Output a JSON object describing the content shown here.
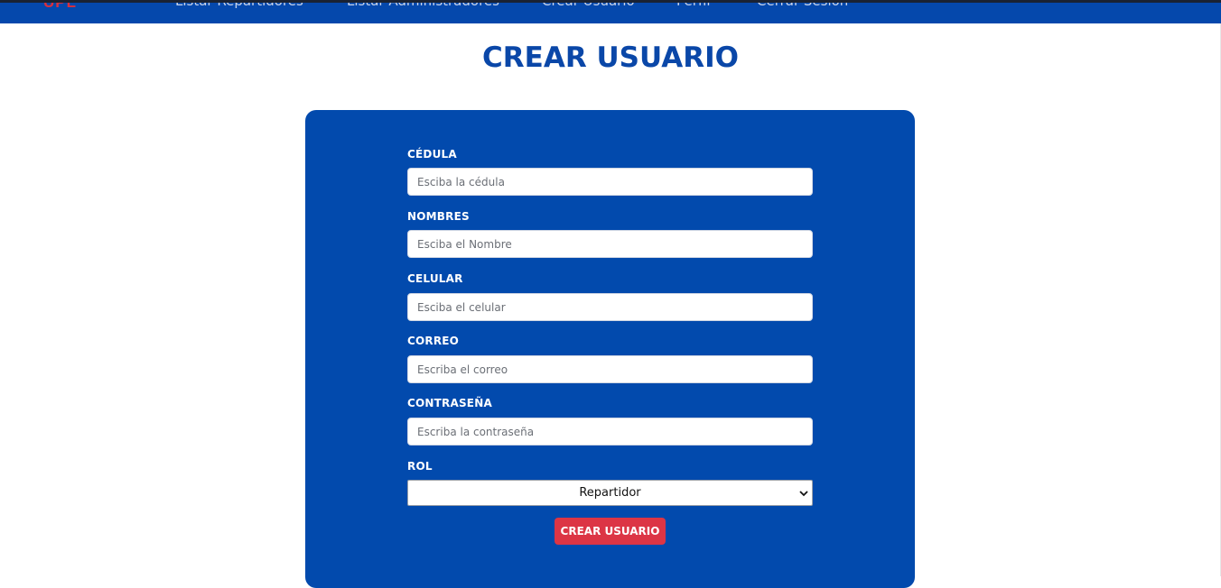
{
  "header": {
    "brand": "UPL",
    "nav": [
      {
        "label": "Listar Repartidores"
      },
      {
        "label": "Listar Administradores"
      },
      {
        "label": "Crear Usuario"
      },
      {
        "label": "Perfil"
      },
      {
        "label": "Cerrar Sesión"
      }
    ]
  },
  "page": {
    "title": "CREAR USUARIO"
  },
  "form": {
    "fields": [
      {
        "label": "CÉDULA",
        "placeholder": "Esciba la cédula",
        "value": ""
      },
      {
        "label": "NOMBRES",
        "placeholder": "Esciba el Nombre",
        "value": ""
      },
      {
        "label": "CELULAR",
        "placeholder": "Esciba el celular",
        "value": ""
      },
      {
        "label": "CORREO",
        "placeholder": "Escriba el correo",
        "value": ""
      },
      {
        "label": "CONTRASEÑA",
        "placeholder": "Escriba la contraseña",
        "value": ""
      }
    ],
    "role": {
      "label": "ROL",
      "selected": "Repartidor"
    },
    "submit_label": "CREAR USUARIO"
  },
  "colors": {
    "navbar": "#0548ac",
    "card": "#024aad",
    "title": "#0a47a8",
    "submit": "#dc3545",
    "brand": "#d9303c"
  },
  "icons": {
    "select_arrow": "chevron-down-icon"
  }
}
